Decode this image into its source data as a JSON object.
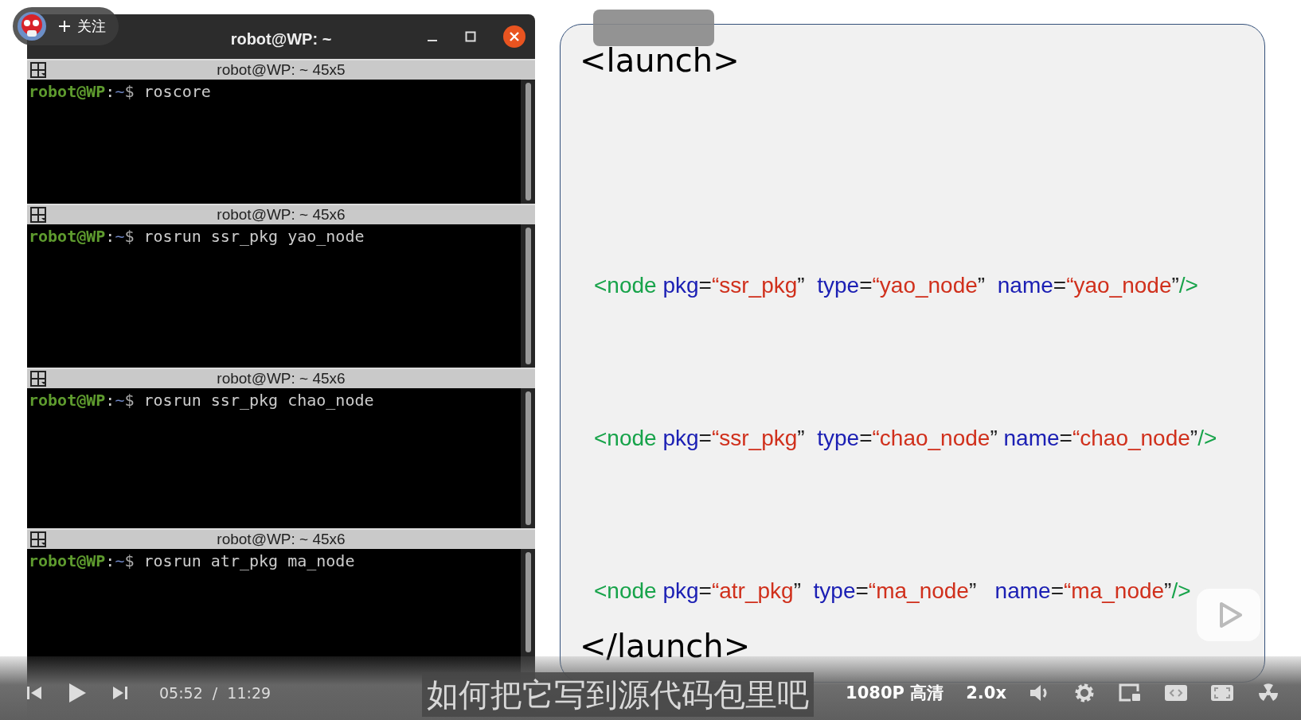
{
  "follow_badge": {
    "label": "关注"
  },
  "terminal": {
    "title": "robot@WP: ~",
    "panes": [
      {
        "header": "robot@WP: ~ 45x5",
        "user": "robot@WP",
        "sep": ":",
        "path": "~",
        "symbol": "$",
        "command": "roscore"
      },
      {
        "header": "robot@WP: ~ 45x6",
        "user": "robot@WP",
        "sep": ":",
        "path": "~",
        "symbol": "$",
        "command": "rosrun ssr_pkg yao_node"
      },
      {
        "header": "robot@WP: ~ 45x6",
        "user": "robot@WP",
        "sep": ":",
        "path": "~",
        "symbol": "$",
        "command": "rosrun ssr_pkg chao_node"
      },
      {
        "header": "robot@WP: ~ 45x6",
        "user": "robot@WP",
        "sep": ":",
        "path": "~",
        "symbol": "$",
        "command": "rosrun atr_pkg ma_node"
      }
    ]
  },
  "slide": {
    "open_tag": "<launch>",
    "close_tag": "</launch>",
    "lines": [
      [
        {
          "text": "<node",
          "kind": "tag"
        },
        {
          "text": " pkg",
          "kind": "attr"
        },
        {
          "text": "=",
          "kind": "punct"
        },
        {
          "text": "“ssr_pkg",
          "kind": "value"
        },
        {
          "text": "”  ",
          "kind": "punct"
        },
        {
          "text": "type",
          "kind": "attr"
        },
        {
          "text": "=",
          "kind": "punct"
        },
        {
          "text": "“yao_node",
          "kind": "value"
        },
        {
          "text": "”  ",
          "kind": "punct"
        },
        {
          "text": "name",
          "kind": "attr"
        },
        {
          "text": "=",
          "kind": "punct"
        },
        {
          "text": "“yao_node",
          "kind": "value"
        },
        {
          "text": "”",
          "kind": "punct"
        },
        {
          "text": "/>",
          "kind": "tag"
        }
      ],
      [
        {
          "text": "<node",
          "kind": "tag"
        },
        {
          "text": " pkg",
          "kind": "attr"
        },
        {
          "text": "=",
          "kind": "punct"
        },
        {
          "text": "“ssr_pkg",
          "kind": "value"
        },
        {
          "text": "”  ",
          "kind": "punct"
        },
        {
          "text": "type",
          "kind": "attr"
        },
        {
          "text": "=",
          "kind": "punct"
        },
        {
          "text": "“chao_node",
          "kind": "value"
        },
        {
          "text": "” ",
          "kind": "punct"
        },
        {
          "text": "name",
          "kind": "attr"
        },
        {
          "text": "=",
          "kind": "punct"
        },
        {
          "text": "“chao_node",
          "kind": "value"
        },
        {
          "text": "”",
          "kind": "punct"
        },
        {
          "text": "/>",
          "kind": "tag"
        }
      ],
      [
        {
          "text": "<node",
          "kind": "tag"
        },
        {
          "text": " pkg",
          "kind": "attr"
        },
        {
          "text": "=",
          "kind": "punct"
        },
        {
          "text": "“atr_pkg",
          "kind": "value"
        },
        {
          "text": "”  ",
          "kind": "punct"
        },
        {
          "text": "type",
          "kind": "attr"
        },
        {
          "text": "=",
          "kind": "punct"
        },
        {
          "text": "“ma_node",
          "kind": "value"
        },
        {
          "text": "”   ",
          "kind": "punct"
        },
        {
          "text": "name",
          "kind": "attr"
        },
        {
          "text": "=",
          "kind": "punct"
        },
        {
          "text": "“ma_node",
          "kind": "value"
        },
        {
          "text": "”",
          "kind": "punct"
        },
        {
          "text": "/>",
          "kind": "tag"
        }
      ]
    ]
  },
  "player": {
    "time_current": "05:52",
    "time_separator": "/",
    "time_total": "11:29",
    "quality": "1080P 高清",
    "speed": "2.0x",
    "subtitle": "如何把它写到源代码包里吧"
  }
}
